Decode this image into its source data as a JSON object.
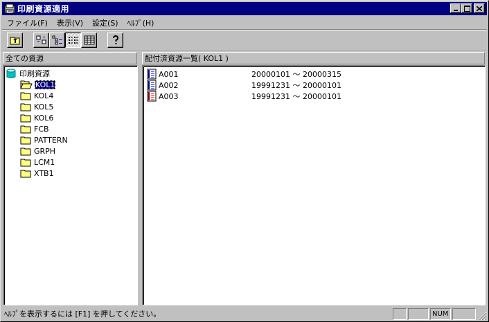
{
  "window": {
    "title": "印刷資源適用",
    "minimize_label": "_",
    "maximize_label": "□",
    "close_label": "✕"
  },
  "menu": [
    "ファイル(F)",
    "表示(V)",
    "設定(S)",
    "ﾍﾙﾌﾟ(H)"
  ],
  "toolbar": {
    "buttons": [
      "up-folder",
      "large-icons",
      "small-icons",
      "list",
      "details",
      "help"
    ],
    "pressed": "list"
  },
  "left_pane": {
    "header": "全ての資源",
    "root": "印刷資源",
    "items": [
      "KOL1",
      "KOL4",
      "KOL5",
      "KOL6",
      "FCB",
      "PATTERN",
      "GRPH",
      "LCM1",
      "XTB1"
    ],
    "selected": "KOL1"
  },
  "right_pane": {
    "header": "配付済資源一覧( KOL1 )",
    "rows": [
      {
        "name": "A001",
        "range": "20000101 ～ 20000315"
      },
      {
        "name": "A002",
        "range": "19991231 ～ 20000101"
      },
      {
        "name": "A003",
        "range": "19991231 ～ 20000101"
      }
    ]
  },
  "statusbar": {
    "text": "ﾍﾙﾌﾟを表示するには [F1] を押してください。",
    "num": "NUM"
  },
  "colors": {
    "titlebar": "#000080",
    "face": "#c0c0c0",
    "selection": "#000080",
    "folder": "#ffff80"
  }
}
